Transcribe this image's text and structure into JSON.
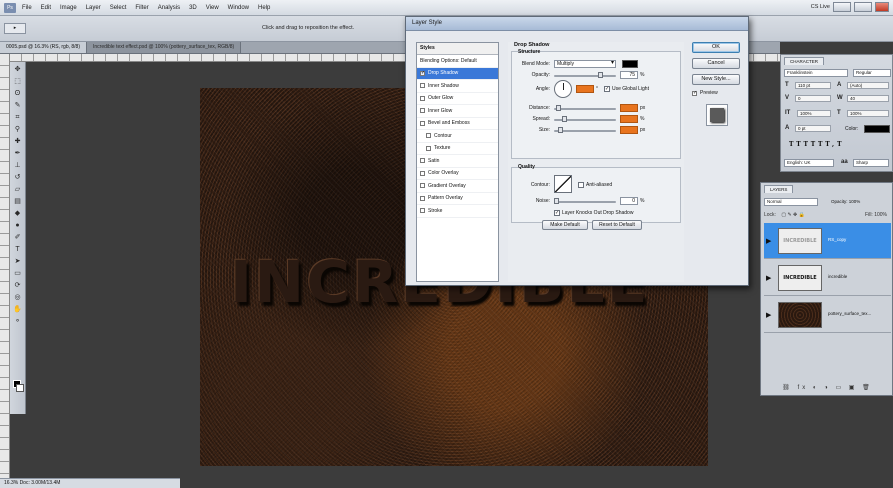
{
  "menubar": {
    "logo": "Ps",
    "items": [
      "File",
      "Edit",
      "Image",
      "Layer",
      "Select",
      "Filter",
      "Analysis",
      "3D",
      "View",
      "Window",
      "Help"
    ],
    "workspace": "CS Live"
  },
  "options": {
    "hint": "Click and drag to reposition the effect."
  },
  "doc_tabs": [
    {
      "label": "0005.psd @ 16.3% (RS, rgb, 8/8)"
    },
    {
      "label": "Incredible text effect.psd @ 100% (pottery_surface_tex, RGB/8)"
    }
  ],
  "canvas": {
    "text": "INCREDIBLE"
  },
  "dialog": {
    "title": "Layer Style",
    "styles_header": "Styles",
    "styles": [
      {
        "label": "Blending Options: Default",
        "checkbox": false,
        "indent": false,
        "selected": false
      },
      {
        "label": "Drop Shadow",
        "checkbox": true,
        "checked": true,
        "indent": false,
        "selected": true
      },
      {
        "label": "Inner Shadow",
        "checkbox": true,
        "indent": false,
        "selected": false
      },
      {
        "label": "Outer Glow",
        "checkbox": true,
        "indent": false,
        "selected": false
      },
      {
        "label": "Inner Glow",
        "checkbox": true,
        "indent": false,
        "selected": false
      },
      {
        "label": "Bevel and Emboss",
        "checkbox": true,
        "indent": false,
        "selected": false
      },
      {
        "label": "Contour",
        "checkbox": true,
        "indent": true,
        "selected": false
      },
      {
        "label": "Texture",
        "checkbox": true,
        "indent": true,
        "selected": false
      },
      {
        "label": "Satin",
        "checkbox": true,
        "indent": false,
        "selected": false
      },
      {
        "label": "Color Overlay",
        "checkbox": true,
        "indent": false,
        "selected": false
      },
      {
        "label": "Gradient Overlay",
        "checkbox": true,
        "indent": false,
        "selected": false
      },
      {
        "label": "Pattern Overlay",
        "checkbox": true,
        "indent": false,
        "selected": false
      },
      {
        "label": "Stroke",
        "checkbox": true,
        "indent": false,
        "selected": false
      }
    ],
    "section_title": "Drop Shadow",
    "structure_title": "Structure",
    "blend_mode_label": "Blend Mode:",
    "blend_mode_value": "Multiply",
    "opacity_label": "Opacity:",
    "opacity_value": "75",
    "angle_label": "Angle:",
    "angle_value": "90",
    "global_light_label": "Use Global Light",
    "distance_label": "Distance:",
    "distance_value": "10",
    "spread_label": "Spread:",
    "spread_value": "15",
    "size_label": "Size:",
    "size_value": "15",
    "px": "px",
    "pct": "%",
    "quality_title": "Quality",
    "contour_label": "Contour:",
    "anti_aliased_label": "Anti-aliased",
    "noise_label": "Noise:",
    "noise_value": "0",
    "knockout_label": "Layer Knocks Out Drop Shadow",
    "make_default": "Make Default",
    "reset_default": "Reset to Default",
    "ok": "OK",
    "cancel": "Cancel",
    "new_style": "New Style...",
    "preview": "Preview",
    "accent_color": "#e8741e"
  },
  "character": {
    "tab": "CHARACTER",
    "font": "Franklinstein",
    "style": "Regular",
    "size": "110 pt",
    "leading": "(Auto)",
    "kerning": "0",
    "tracking": "40",
    "vscale": "100%",
    "hscale": "100%",
    "baseline": "0 pt",
    "color_label": "Color:",
    "language": "English: UK",
    "aa": "Sharp"
  },
  "layers": {
    "tab": "LAYERS",
    "blend": "Normal",
    "opacity": "Opacity: 100%",
    "lock": "Lock:",
    "fill": "Fill: 100%",
    "rows": [
      {
        "thumb": "INCREDIBLE",
        "name": "RS_copy",
        "active": true
      },
      {
        "thumb": "INCREDIBLE",
        "name": "incredible",
        "active": false
      },
      {
        "thumb": "",
        "name": "pottery_surface_tex...",
        "active": false
      }
    ],
    "footer": "⛓ fx ◐ ◑ ▭ ▣ 🗑"
  },
  "status": {
    "text": "16.3%   Doc: 3.00M/13.4M"
  }
}
